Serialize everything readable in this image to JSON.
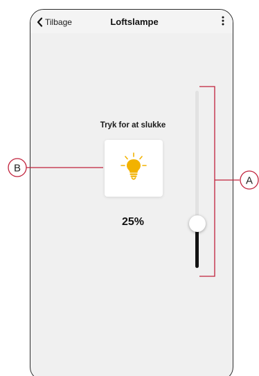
{
  "header": {
    "back_label": "Tilbage",
    "title": "Loftslampe",
    "back_icon": "chevron-left-icon",
    "menu_icon": "kebab-menu-icon"
  },
  "main": {
    "prompt": "Tryk for at slukke",
    "lamp_icon": "light-bulb-icon",
    "level_label": "25%",
    "level_fraction": 0.25
  },
  "annotations": {
    "a_label": "A",
    "b_label": "B",
    "callout_color": "#c0203a"
  },
  "colors": {
    "bulb": "#f2b200",
    "slider_fill": "#111111",
    "slider_track": "#e2e2e2"
  }
}
